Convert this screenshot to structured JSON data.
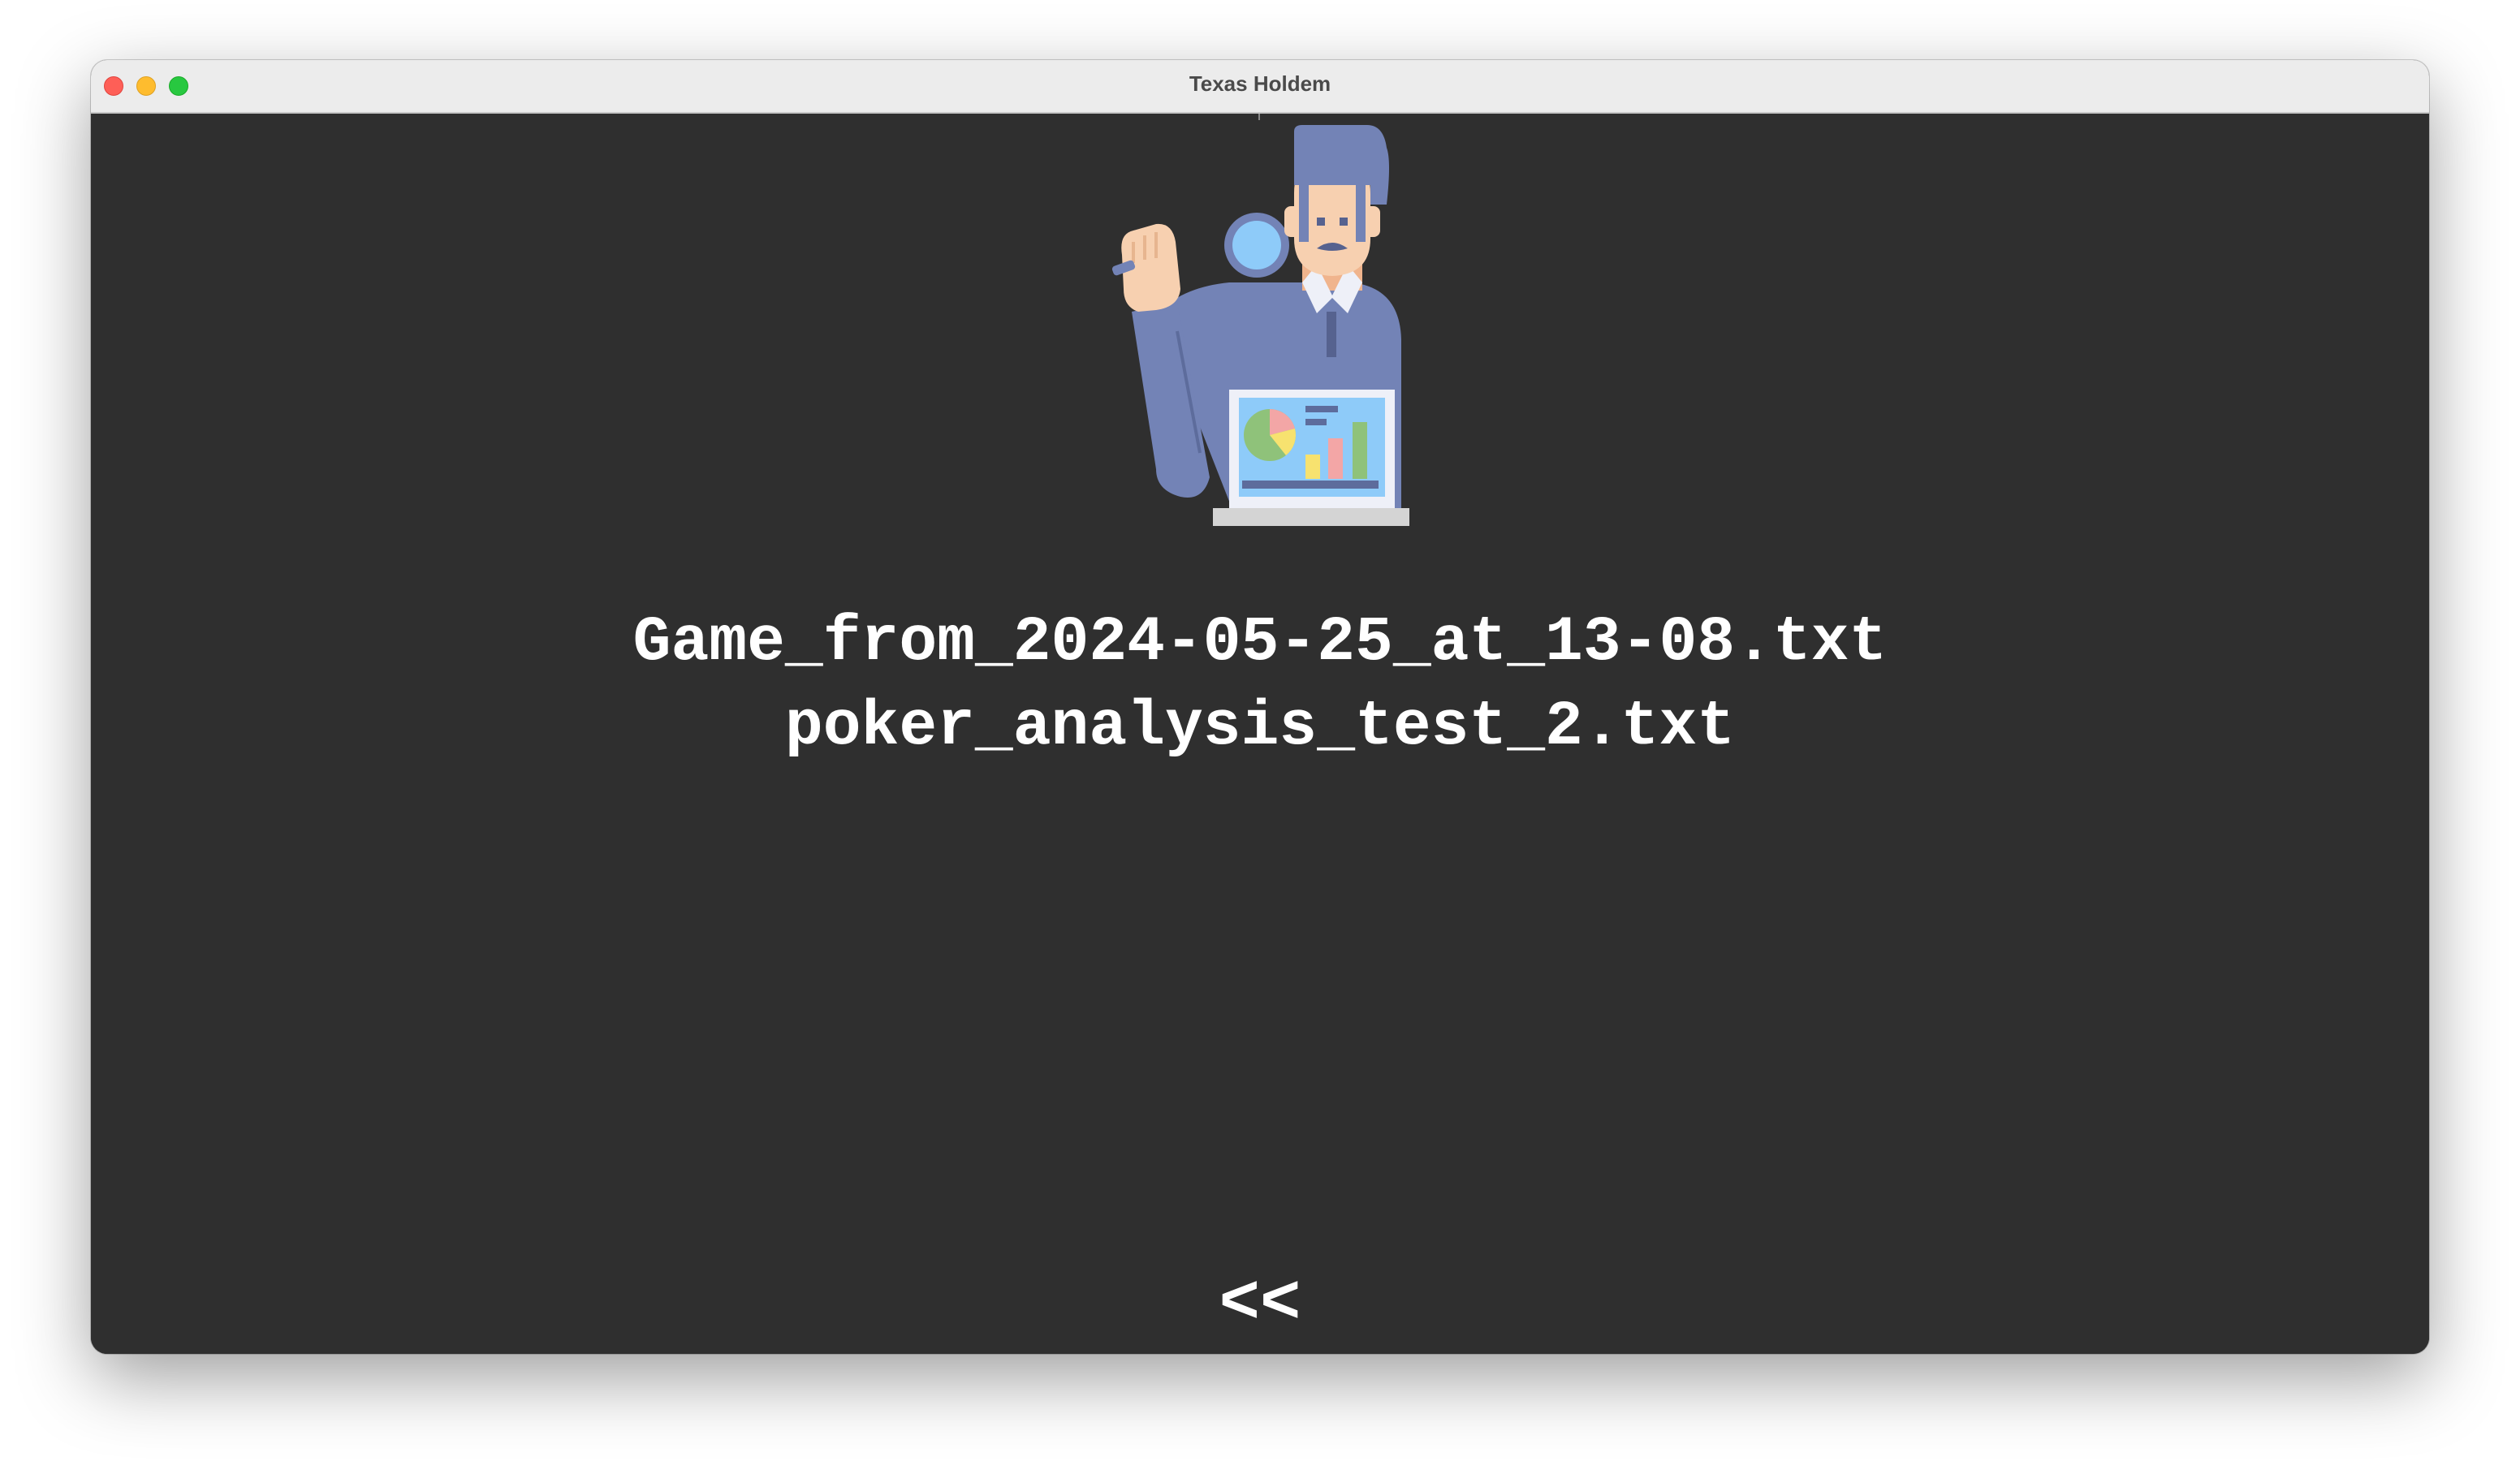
{
  "window": {
    "title": "Texas Holdem"
  },
  "illustration": {
    "icon": "analyst-with-magnifier-and-laptop-chart"
  },
  "files": [
    {
      "name": "Game_from_2024-05-25_at_13-08.txt"
    },
    {
      "name": "poker_analysis_test_2.txt"
    }
  ],
  "navigation": {
    "back_label": "<<"
  },
  "colors": {
    "background": "#2f2f2f",
    "text": "#ffffff",
    "titlebar": "#ececec"
  }
}
